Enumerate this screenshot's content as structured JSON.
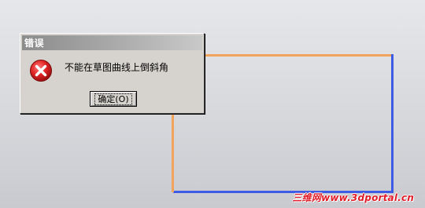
{
  "dialog": {
    "title": "错误",
    "message": "不能在草图曲线上倒斜角",
    "ok_label": "确定(O)",
    "icon": "error-icon"
  },
  "watermark": {
    "text": "三维网www.3dportal.cn"
  },
  "colors": {
    "edge_orange": "#f2a45c",
    "edge_blue": "#3e5be6",
    "error_red": "#d62828",
    "watermark_red": "#e21d2a"
  }
}
